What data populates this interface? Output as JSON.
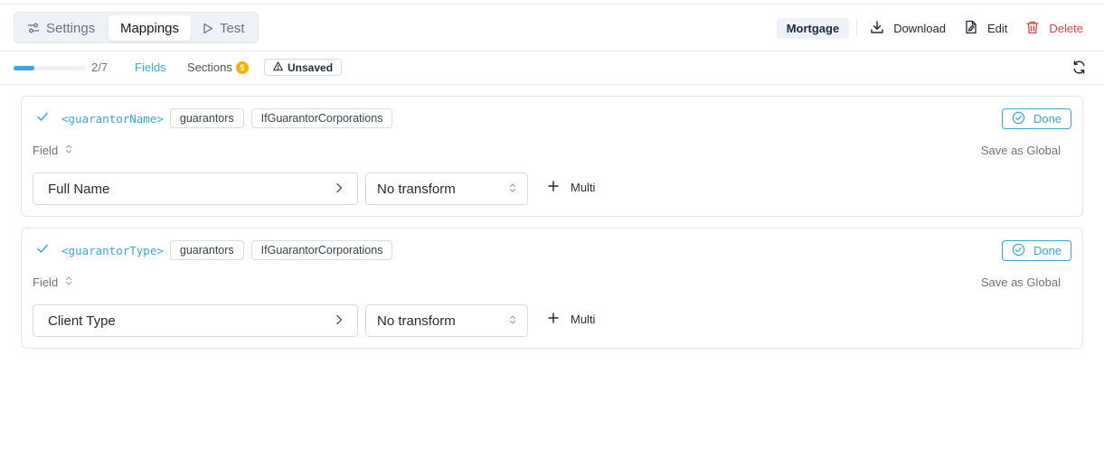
{
  "tabs": [
    {
      "label": "Settings",
      "icon": "sliders-icon"
    },
    {
      "label": "Mappings",
      "active": true
    },
    {
      "label": "Test",
      "icon": "play-icon"
    }
  ],
  "header": {
    "badge": "Mortgage",
    "download_label": "Download",
    "edit_label": "Edit",
    "delete_label": "Delete"
  },
  "subbar": {
    "progress_text": "2/7",
    "progress_fraction": 0.286,
    "fields_label": "Fields",
    "sections_label": "Sections",
    "sections_count": "5",
    "unsaved_label": "Unsaved"
  },
  "mappings": [
    {
      "var_name": "<guarantorName>",
      "chips": [
        "guarantors",
        "IfGuarantorCorporations"
      ],
      "done_label": "Done",
      "field_label": "Field",
      "save_global_label": "Save as Global",
      "field_value": "Full Name",
      "transform_value": "No transform",
      "multi_label": "Multi"
    },
    {
      "var_name": "<guarantorType>",
      "chips": [
        "guarantors",
        "IfGuarantorCorporations"
      ],
      "done_label": "Done",
      "field_label": "Field",
      "save_global_label": "Save as Global",
      "field_value": "Client Type",
      "transform_value": "No transform",
      "multi_label": "Multi"
    }
  ],
  "colors": {
    "accent": "#3ba6d9",
    "danger": "#e0414b",
    "badge_count": "#f4b400"
  }
}
